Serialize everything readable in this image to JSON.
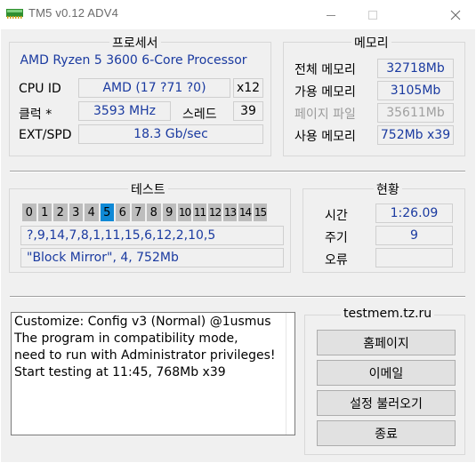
{
  "window": {
    "title": "TM5 v0.12 ADV4",
    "minimize_icon": "minimize-icon",
    "maximize_icon": "maximize-icon",
    "close_icon": "close-icon"
  },
  "processor": {
    "group_title": "프로세서",
    "name": "AMD Ryzen 5 3600 6-Core Processor",
    "cpu_id_label": "CPU ID",
    "cpu_id_value": "AMD  (17 ?71 ?0)",
    "cores_value": "x12",
    "clock_label": "클럭 *",
    "clock_value": "3593 MHz",
    "threads_label": "스레드",
    "threads_value": "39",
    "extspd_label": "EXT/SPD",
    "extspd_value": "18.3 Gb/sec"
  },
  "memory": {
    "group_title": "메모리",
    "rows": [
      {
        "label": "전체 메모리",
        "value": "32718Mb",
        "disabled": false
      },
      {
        "label": "가용 메모리",
        "value": "3105Mb",
        "disabled": false
      },
      {
        "label": "페이지 파일",
        "value": "35611Mb",
        "disabled": true
      },
      {
        "label": "사용 메모리",
        "value": "752Mb x39",
        "disabled": false
      }
    ]
  },
  "test": {
    "group_title": "테스트",
    "numbers": [
      "0",
      "1",
      "2",
      "3",
      "4",
      "5",
      "6",
      "7",
      "8",
      "9",
      "10",
      "11",
      "12",
      "13",
      "14",
      "15"
    ],
    "active_index": 5,
    "sequence": "?,9,14,7,8,1,11,15,6,12,2,10,5",
    "current": "\"Block Mirror\", 4, 752Mb"
  },
  "status": {
    "group_title": "현황",
    "time_label": "시간",
    "time_value": "1:26.09",
    "cycle_label": "주기",
    "cycle_value": "9",
    "error_label": "오류",
    "error_value": ""
  },
  "log": {
    "lines": [
      "Customize: Config v3 (Normal) @1usmus",
      "The program in compatibility mode,",
      "need to run with Administrator privileges!",
      "Start testing at 11:45, 768Mb x39"
    ]
  },
  "links": {
    "site": "testmem.tz.ru",
    "homepage_button": "홈페이지",
    "email_button": "이메일",
    "load_settings_button": "설정 불러오기",
    "exit_button": "종료"
  },
  "colors": {
    "accent_value_text": "#1a3aa0",
    "active_test": "#0f89d6",
    "test_cell": "#bdbdbd",
    "dialog_bg": "#f0f0f0"
  }
}
